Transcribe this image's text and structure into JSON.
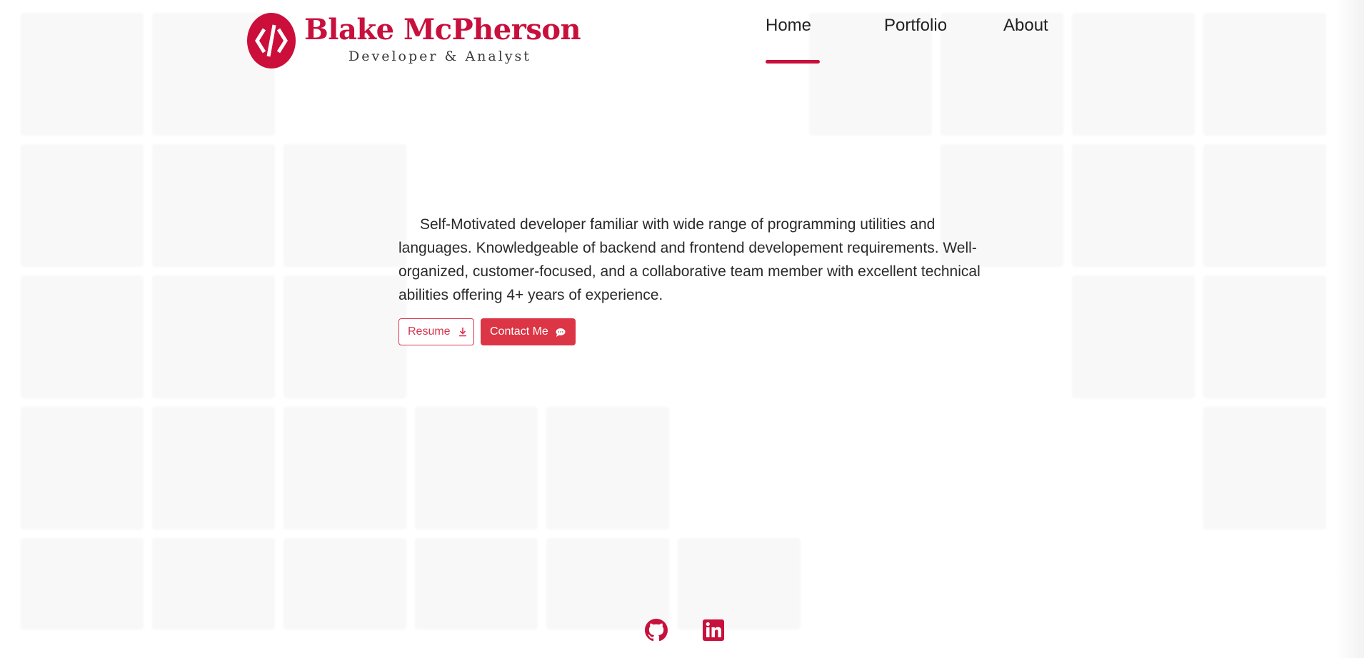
{
  "brand": {
    "name": "Blake McPherson",
    "tagline": "Developer & Analyst",
    "logo_icon": "code-brackets-icon",
    "accent_color": "#c8103d"
  },
  "nav": {
    "items": [
      {
        "label": "Home",
        "active": true
      },
      {
        "label": "Portfolio",
        "active": false
      },
      {
        "label": "About",
        "active": false
      }
    ]
  },
  "hero": {
    "description": "Self-Motivated developer familiar with wide range of programming utilities and languages. Knowledgeable of backend and frontend developement requirements. Well-organized, customer-focused, and a collaborative team member with excellent technical abilities offering 4+ years of experience.",
    "buttons": {
      "resume": {
        "label": "Resume",
        "icon": "download-icon"
      },
      "contact": {
        "label": "Contact Me",
        "icon": "chat-bubble-icon"
      }
    }
  },
  "socials": [
    {
      "name": "GitHub",
      "icon": "github-icon"
    },
    {
      "name": "LinkedIn",
      "icon": "linkedin-icon"
    }
  ]
}
